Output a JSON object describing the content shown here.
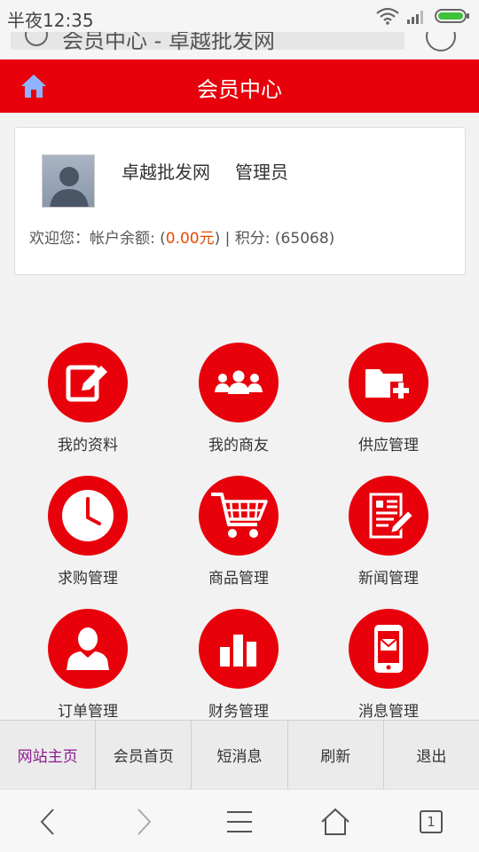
{
  "status": {
    "time": "半夜12:35"
  },
  "browser": {
    "url_text": "会员中心 - 卓越批发网"
  },
  "header": {
    "title": "会员中心"
  },
  "user": {
    "name": "卓越批发网",
    "role": "管理员",
    "info_prefix": "欢迎您：帐户余额: (",
    "balance": "0.00元",
    "info_suffix": ") | 积分: (65068)"
  },
  "menu": [
    {
      "label": "我的资料",
      "icon": "edit-profile-icon"
    },
    {
      "label": "我的商友",
      "icon": "friends-icon"
    },
    {
      "label": "供应管理",
      "icon": "folder-add-icon"
    },
    {
      "label": "求购管理",
      "icon": "clock-icon"
    },
    {
      "label": "商品管理",
      "icon": "shopping-cart-icon"
    },
    {
      "label": "新闻管理",
      "icon": "news-edit-icon"
    },
    {
      "label": "订单管理",
      "icon": "person-icon"
    },
    {
      "label": "财务管理",
      "icon": "bar-chart-icon"
    },
    {
      "label": "消息管理",
      "icon": "mobile-message-icon"
    }
  ],
  "bottom_nav": [
    "网站主页",
    "会员首页",
    "短消息",
    "刷新",
    "退出"
  ],
  "browser_toolbar": {
    "tab_count": "1"
  },
  "colors": {
    "brand": "#e8000b",
    "balance": "#e64a00",
    "active_tab": "#8b1a8f"
  }
}
